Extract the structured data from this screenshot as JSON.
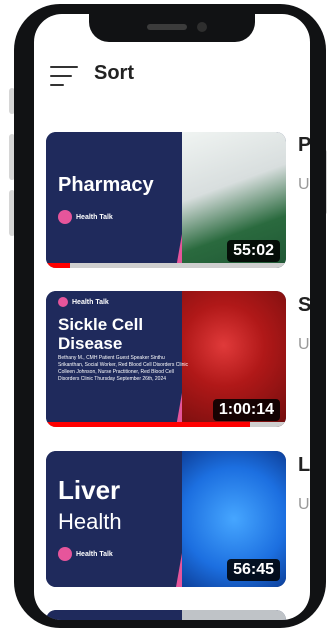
{
  "header": {
    "title": "Sort",
    "sort_icon": "sort-lines-icon"
  },
  "videos": [
    {
      "thumbnail_title": "Pharmacy",
      "brand": "Health Talk",
      "duration": "55:02",
      "progress": 0.1,
      "title_visible": "P",
      "subtitle_visible": "U"
    },
    {
      "thumbnail_title": "Sickle Cell Disease",
      "brand": "Health Talk",
      "credits": "Bethany M., CMH Patient Guest Speaker  Sinthu Srikanthan, Social Worker, Red Blood Cell Disorders Clinic  Colleen Johnson, Nurse Practitioner, Red Blood Cell Disorders Clinic  Thursday September 26th, 2024",
      "duration": "1:00:14",
      "progress": 0.85,
      "title_visible": "S",
      "subtitle_visible": "U"
    },
    {
      "thumbnail_title_1": "Liver",
      "thumbnail_title_2": "Health",
      "brand": "Health Talk",
      "duration": "56:45",
      "progress": 0,
      "title_visible": "L",
      "subtitle_visible": "U"
    }
  ],
  "colors": {
    "thumb_bg": "#1f2a5c",
    "accent_pink": "#e6559b",
    "progress_red": "#ff0000"
  }
}
